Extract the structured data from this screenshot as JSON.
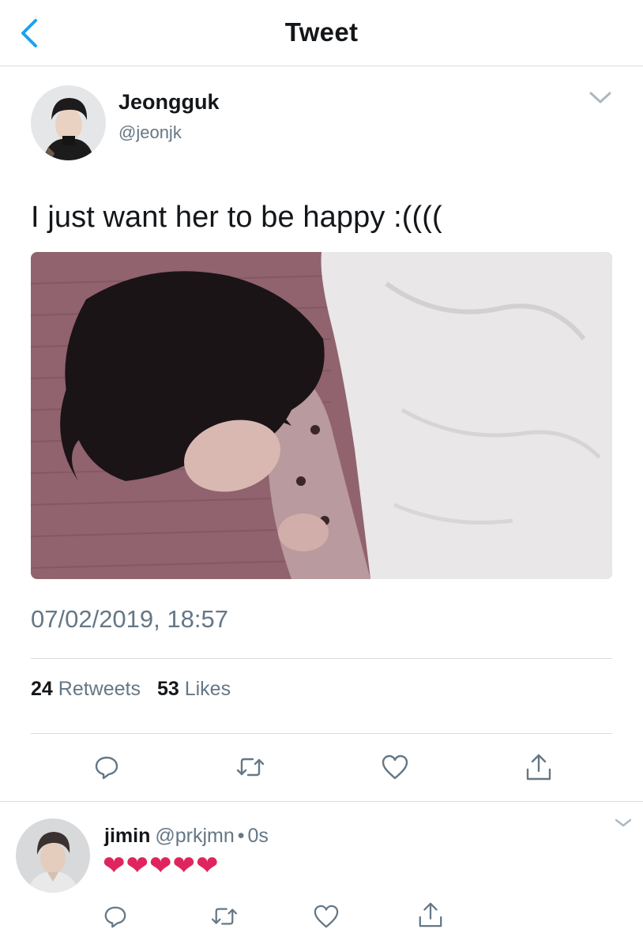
{
  "nav": {
    "title": "Tweet"
  },
  "tweet": {
    "display_name": "Jeongguk",
    "handle": "@jeonjk",
    "text": "I just want her to be happy :((((",
    "timestamp": "07/02/2019, 18:57",
    "retweets_count": "24",
    "retweets_label": "Retweets",
    "likes_count": "53",
    "likes_label": "Likes"
  },
  "reply": {
    "display_name": "jimin",
    "handle": "@prkjmn",
    "separator": "•",
    "time": "0s",
    "text": "❤❤❤❤❤"
  },
  "colors": {
    "accent": "#1da1f2",
    "secondary_text": "#657786",
    "divider": "#d8dde2",
    "heart": "#e0245e"
  },
  "icons": [
    "back-chevron-icon",
    "chevron-down-icon",
    "reply-icon",
    "retweet-icon",
    "like-icon",
    "share-icon"
  ]
}
